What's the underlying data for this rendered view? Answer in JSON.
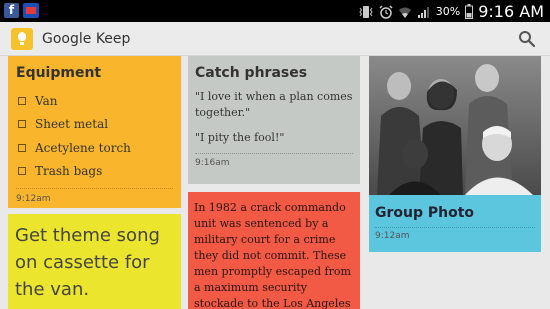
{
  "status_bar": {
    "battery": "30%",
    "time": "9:16 AM",
    "left_icons": [
      "facebook-icon",
      "media-icon"
    ],
    "right_icons": [
      "vibrate-icon",
      "alarm-icon",
      "wifi-icon",
      "signal-icon",
      "battery-icon"
    ]
  },
  "app": {
    "title": "Google Keep",
    "logo_icon": "keep-bulb-icon",
    "search_icon": "search-icon"
  },
  "notes": {
    "equipment": {
      "title": "Equipment",
      "items": [
        "Van",
        "Sheet metal",
        "Acetylene torch",
        "Trash bags"
      ],
      "time": "9:12am",
      "color": "#f9b52b"
    },
    "theme": {
      "text": "Get theme song on cassette for the van.",
      "color": "#ece52d"
    },
    "catch": {
      "title": "Catch phrases",
      "quote1": "\"I love it when a plan comes together.\"",
      "quote2": "\"I pity the fool!\"",
      "time": "9:16am",
      "color": "#c4c9c5"
    },
    "story": {
      "text": "In 1982 a crack commando unit was sentenced by a military court for a crime they did not commit. These men promptly escaped from a maximum security stockade to the Los Angeles",
      "color": "#f25a45"
    },
    "photo": {
      "title": "Group Photo",
      "time": "9:12am",
      "color": "#5cc6de"
    }
  }
}
